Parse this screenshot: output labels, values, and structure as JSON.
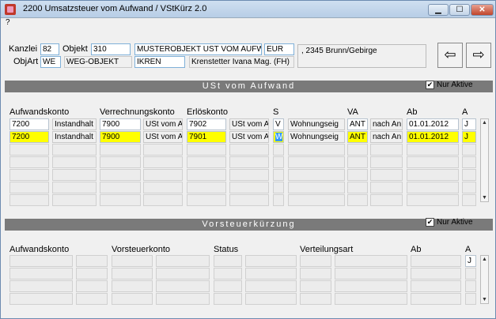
{
  "window": {
    "title": "2200 Umsatzsteuer vom Aufwand / VStKürz 2.0",
    "minimize": "▁",
    "maximize": "☐",
    "close": "✕"
  },
  "menu": {
    "help": "?"
  },
  "header": {
    "kanzlei_label": "Kanzlei",
    "kanzlei": "82",
    "objekt_label": "Objekt",
    "objekt": "310",
    "objekt_name": "MUSTEROBJEKT UST VOM AUFW",
    "currency": "EUR",
    "objart_label": "ObjArt",
    "objart": "WE",
    "objart_name": "WEG-OBJEKT",
    "user_code": "IKREN",
    "user_name": "Krenstetter Ivana Mag. (FH)",
    "address": ", 2345 Brunn/Gebirge",
    "prev": "⇦",
    "next": "⇨"
  },
  "ust": {
    "title": "USt vom Aufwand",
    "nur_aktive": "Nur Aktive",
    "nur_aktive_checked": "✔",
    "col_aufwandskonto": "Aufwandskonto",
    "col_verrechnungskonto": "Verrechnungskonto",
    "col_erloeskonto": "Erlöskonto",
    "col_s": "S",
    "col_va": "VA",
    "col_ab": "Ab",
    "col_a": "A",
    "rows": [
      {
        "aufw": "7200",
        "aufw_name": "Instandhalt",
        "verr": "7900",
        "verr_name": "USt vom A",
        "erl": "7902",
        "erl_name": "USt vom A",
        "s": "V",
        "va_name": "Wohnungseig",
        "va": "ANT",
        "va_text": "nach An",
        "ab": "01.01.2012",
        "a": "J"
      },
      {
        "aufw": "7200",
        "aufw_name": "Instandhalt",
        "verr": "7900",
        "verr_name": "USt vom A",
        "erl": "7901",
        "erl_name": "USt vom A",
        "s": "W",
        "va_name": "Wohnungseig",
        "va": "ANT",
        "va_text": "nach An",
        "ab": "01.01.2012",
        "a": "J"
      }
    ]
  },
  "vst": {
    "title": "Vorsteuerkürzung",
    "nur_aktive": "Nur Aktive",
    "nur_aktive_checked": "✔",
    "col_aufwandskonto": "Aufwandskonto",
    "col_vorsteuerkonto": "Vorsteuerkonto",
    "col_status": "Status",
    "col_verteilungsart": "Verteilungsart",
    "col_ab": "Ab",
    "col_a": "A",
    "row_a": "J"
  },
  "scroll": {
    "up": "▲",
    "down": "▼"
  }
}
